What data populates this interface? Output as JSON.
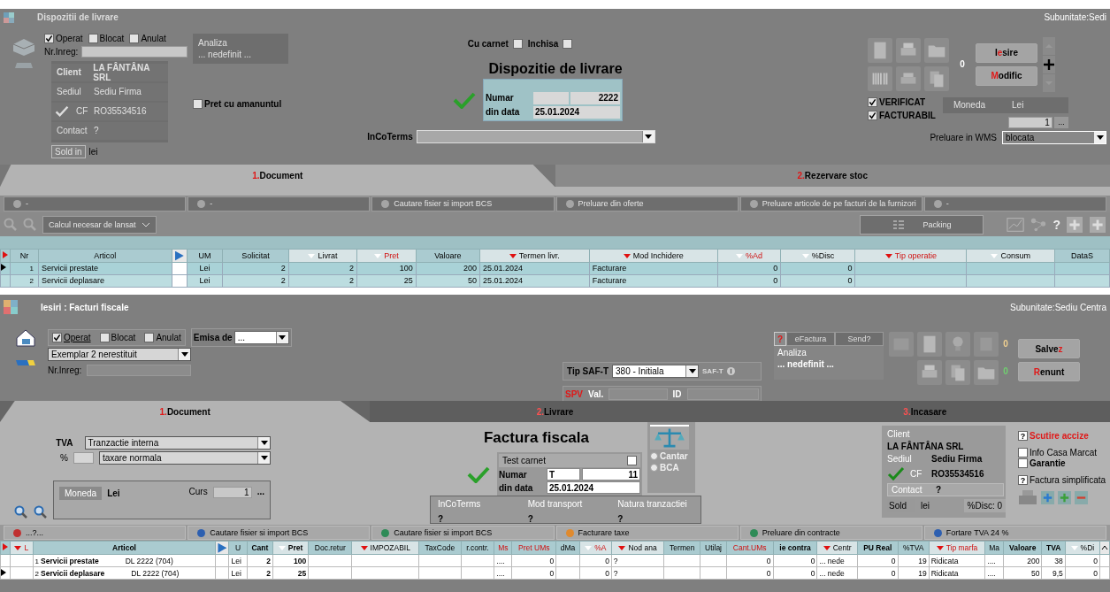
{
  "top": {
    "title": "Dispozitii de livrare",
    "subunit": "Subunitate:Sedi",
    "flags": [
      {
        "label": "Operat",
        "checked": true
      },
      {
        "label": "Blocat",
        "checked": false
      },
      {
        "label": "Anulat",
        "checked": false
      }
    ],
    "nr_inreg": "Nr.Inreg:",
    "analiza": {
      "label": "Analiza",
      "value": "... nedefinit ..."
    },
    "partner": [
      {
        "label": "Client",
        "value": "LA FÂNTÂNA SRL"
      },
      {
        "label": "Sediul",
        "value": "Sediu Firma"
      },
      {
        "label": "CF",
        "value": "RO35534516"
      },
      {
        "label": "Contact",
        "value": "?"
      }
    ],
    "sold": {
      "label": "Sold in",
      "value": "lei"
    },
    "retail_price": {
      "label": "Pret cu amanuntul",
      "checked": false
    },
    "cu_carnet": {
      "label": "Cu carnet",
      "checked": false
    },
    "inchisa": {
      "label": "Inchisa",
      "checked": false
    },
    "doc_title": "Dispozitie de livrare",
    "numar": {
      "label": "Numar",
      "value": "2222"
    },
    "din_data": {
      "label": "din data",
      "value": "25.01.2024"
    },
    "incoterms": "InCoTerms",
    "counter": "0",
    "buttons": [
      {
        "segments": [
          {
            "text": "I",
            "hotkey": false
          },
          {
            "text": "e",
            "hotkey": true
          },
          {
            "text": "sire",
            "hotkey": false
          }
        ]
      },
      {
        "segments": [
          {
            "text": "M",
            "hotkey": true
          },
          {
            "text": "odific",
            "hotkey": false
          }
        ]
      }
    ],
    "checks": [
      {
        "label": "VERIFICAT",
        "checked": true
      },
      {
        "label": "FACTURABIL",
        "checked": true
      }
    ],
    "moneda": {
      "label": "Moneda",
      "value": "Lei"
    },
    "rate": "1",
    "rate_button": "...",
    "wms": {
      "label": "Preluare in WMS",
      "value": "blocata"
    },
    "tabs": [
      {
        "number": "1.",
        "label": " Document",
        "selected": true
      },
      {
        "number": "2.",
        "label": " Rezervare stoc",
        "selected": false
      }
    ],
    "actions": [
      "-",
      "-",
      "Cautare fisier si import BCS",
      "Preluare din oferte",
      "Preluare articole de pe facturi de la furnizori",
      "-"
    ],
    "calcul": "Calcul necesar de lansat",
    "packing": "Packing",
    "help": "?",
    "columns": [
      {
        "label": "Nr",
        "alert": false
      },
      {
        "label": "Articol",
        "alert": false
      },
      {
        "label": "UM",
        "alert": false,
        "values": [
          "Lei",
          "Lei"
        ]
      },
      {
        "label": "Solicitat",
        "alert": false,
        "values": [
          "2",
          "2"
        ]
      },
      {
        "label": "Livrat",
        "alert": false,
        "color": "#ffffff",
        "values": [
          "2",
          "2"
        ]
      },
      {
        "label": "Pret",
        "alert": true,
        "color": "#ffffff",
        "values": [
          "100",
          "25"
        ]
      },
      {
        "label": "Valoare",
        "alert": false,
        "values": [
          "200",
          "50"
        ]
      },
      {
        "label": "Termen livr.",
        "alert": false,
        "color": "#e01010",
        "values": [
          "25.01.2024",
          "25.01.2024"
        ]
      },
      {
        "label": "Mod Inchidere",
        "alert": false,
        "color": "#e01010",
        "values": [
          "Facturare",
          "Facturare"
        ]
      },
      {
        "label": "%Ad",
        "alert": true,
        "color": "#ffffff",
        "values": [
          "0",
          "0"
        ]
      },
      {
        "label": "%Disc",
        "alert": false,
        "color": "#ffffff",
        "values": [
          "0",
          "0"
        ]
      },
      {
        "label": "Tip operatie",
        "alert": true,
        "color": "#e01010"
      },
      {
        "label": "Consum",
        "alert": false,
        "color": "#ffffff"
      },
      {
        "label": "DataS",
        "alert": false
      }
    ],
    "rows": [
      {
        "selected": true,
        "nr": "1",
        "article": "Servicii prestate"
      },
      {
        "selected": false,
        "nr": "2",
        "article": "Servicii deplasare"
      }
    ]
  },
  "bottom": {
    "title": "Iesiri : Facturi fiscale",
    "subunit": "Subunitate:Sediu Centra",
    "flags": [
      {
        "label": "Operat",
        "checked": true
      },
      {
        "label": "Blocat",
        "checked": false
      },
      {
        "label": "Anulat",
        "checked": false
      }
    ],
    "emisa": {
      "label": "Emisa de",
      "value": "..."
    },
    "exemplar": "Exemplar 2 nerestituit",
    "nr_inreg": "Nr.Inreg:",
    "saft": {
      "label": "Tip SAF-T",
      "value": "380 - Initiala",
      "badge": "SAF-T"
    },
    "spv": {
      "label": "SPV",
      "val": "Val.",
      "id": "ID"
    },
    "efactura": {
      "help": "?",
      "label": "eFactura",
      "send": "Send?"
    },
    "analiza": {
      "label": "Analiza",
      "value": "... nedefinit ..."
    },
    "counters": [
      "0",
      "0"
    ],
    "buttons": [
      {
        "segments": [
          {
            "text": "Salve",
            "hotkey": false
          },
          {
            "text": "z",
            "hotkey": true
          }
        ]
      },
      {
        "segments": [
          {
            "text": "R",
            "hotkey": true
          },
          {
            "text": "enunt",
            "hotkey": false
          }
        ]
      }
    ],
    "tabs": [
      {
        "number": "1.",
        "label": "Document",
        "selected": true
      },
      {
        "number": "2.",
        "label": "Livrare",
        "selected": false
      },
      {
        "number": "3.",
        "label": "Incasare",
        "selected": false
      }
    ],
    "tva": {
      "label": "TVA",
      "pct": "%",
      "regime": "Tranzactie interna",
      "taxare": "taxare normala"
    },
    "moneda": {
      "label": "Moneda",
      "value": "Lei",
      "curs_label": "Curs",
      "curs": "1",
      "more": "..."
    },
    "doc_title": "Factura fiscala",
    "test_carnet": {
      "label": "Test carnet",
      "checked": false
    },
    "numar": {
      "label": "Numar",
      "series": "T",
      "value": "11"
    },
    "din_data": {
      "label": "din data",
      "value": "25.01.2024"
    },
    "weigh": [
      {
        "label": "Cantar",
        "selected": false
      },
      {
        "label": "BCA",
        "selected": false
      }
    ],
    "info": [
      {
        "label": "InCoTerms",
        "value": "?"
      },
      {
        "label": "Mod transport",
        "value": "?"
      },
      {
        "label": "Natura tranzactiei",
        "value": "?"
      }
    ],
    "partner": {
      "client_label": "Client",
      "client": "LA FÂNTÂNA SRL",
      "sediul_label": "Sediul",
      "sediul": "Sediu Firma",
      "cf_label": "CF",
      "cf": "RO35534516",
      "contact_label": "Contact",
      "contact": "?",
      "sold_label": "Sold",
      "sold": "lei",
      "disc": "%Disc: 0"
    },
    "options": [
      {
        "kind": "question",
        "mark": "?",
        "label": "Scutire accize",
        "alert": true
      },
      {
        "kind": "checkbox",
        "label": "Info Casa Marcat",
        "checked": false,
        "bold": false
      },
      {
        "kind": "checkbox",
        "label": "Garantie",
        "checked": false,
        "bold": true
      },
      {
        "kind": "question",
        "mark": "?",
        "label": "Factura simplificata",
        "alert": false
      }
    ],
    "actions": [
      {
        "label": "...?...",
        "color": "#c03030"
      },
      {
        "label": "Cautare fisier si import BCS",
        "color": "#2d5fb0"
      },
      {
        "label": "Cautare fisier si import BCS",
        "color": "#2e8b57"
      },
      {
        "label": "Facturare taxe",
        "color": "#e08a2e"
      },
      {
        "label": "Preluare din contracte",
        "color": "#2e8b57"
      },
      {
        "label": "Fortare TVA 24 %",
        "color": "#2d5fb0"
      }
    ],
    "columns": [
      {
        "label": "L",
        "alert": true,
        "bold": false,
        "color": "#e01010"
      },
      {
        "label": "Articol",
        "alert": false,
        "bold": true
      },
      {
        "label": "U",
        "alert": false,
        "bold": false,
        "values": [
          "Lei",
          "Lei"
        ]
      },
      {
        "label": "Cant",
        "alert": false,
        "bold": true,
        "values": [
          "2",
          "2"
        ]
      },
      {
        "label": "Pret",
        "alert": false,
        "bold": true,
        "color": "#ffffff",
        "values": [
          "100",
          "25"
        ]
      },
      {
        "label": "Doc.retur",
        "alert": false,
        "bold": false
      },
      {
        "label": "IMPOZABIL",
        "alert": false,
        "bold": false,
        "color": "#e01010"
      },
      {
        "label": "TaxCode",
        "alert": false,
        "bold": false
      },
      {
        "label": "r.contr.",
        "alert": false,
        "bold": false
      },
      {
        "label": "Ms",
        "alert": true,
        "bold": false,
        "values": [
          "....",
          "...."
        ]
      },
      {
        "label": "Pret UMs",
        "alert": true,
        "bold": false,
        "values": [
          "0",
          "0"
        ]
      },
      {
        "label": "dMa",
        "alert": false,
        "bold": false
      },
      {
        "label": "%A",
        "alert": true,
        "bold": false,
        "color": "#ffffff",
        "values": [
          "0",
          "0"
        ]
      },
      {
        "label": "Nod ana",
        "alert": false,
        "bold": false,
        "color": "#e01010",
        "values": [
          "?",
          "?"
        ]
      },
      {
        "label": "Termen",
        "alert": false,
        "bold": false
      },
      {
        "label": "Utilaj",
        "alert": false,
        "bold": false
      },
      {
        "label": "Cant.UMs",
        "alert": true,
        "bold": false,
        "values": [
          "0",
          "0"
        ]
      },
      {
        "label": "ie contra",
        "alert": false,
        "bold": true,
        "values": [
          "0",
          "0"
        ]
      },
      {
        "label": "Centr",
        "alert": false,
        "bold": false,
        "color": "#e01010",
        "values": [
          "... nede",
          "... nede"
        ]
      },
      {
        "label": "PU Real",
        "alert": false,
        "bold": true,
        "values": [
          "0",
          "0"
        ]
      },
      {
        "label": "%TVA",
        "alert": false,
        "bold": false,
        "values": [
          "19",
          "19"
        ]
      },
      {
        "label": "Tip marfa",
        "alert": true,
        "bold": false,
        "color": "#e01010",
        "values": [
          "Ridicata",
          "Ridicata"
        ]
      },
      {
        "label": "Ma",
        "alert": false,
        "bold": false,
        "values": [
          "....",
          "...."
        ]
      },
      {
        "label": "Valoare",
        "alert": false,
        "bold": true,
        "values": [
          "200",
          "50"
        ]
      },
      {
        "label": "TVA",
        "alert": false,
        "bold": true,
        "values": [
          "38",
          "9,5"
        ]
      },
      {
        "label": "%Di",
        "alert": false,
        "bold": false,
        "color": "#ffffff",
        "values": [
          "0",
          "0"
        ]
      }
    ],
    "rows": [
      {
        "selected": false,
        "nr": "1",
        "article": "Servicii prestate",
        "code": "DL  2222 (704)"
      },
      {
        "selected": true,
        "nr": "2",
        "article": "Servicii deplasare",
        "code": "DL  2222 (704)"
      }
    ]
  }
}
